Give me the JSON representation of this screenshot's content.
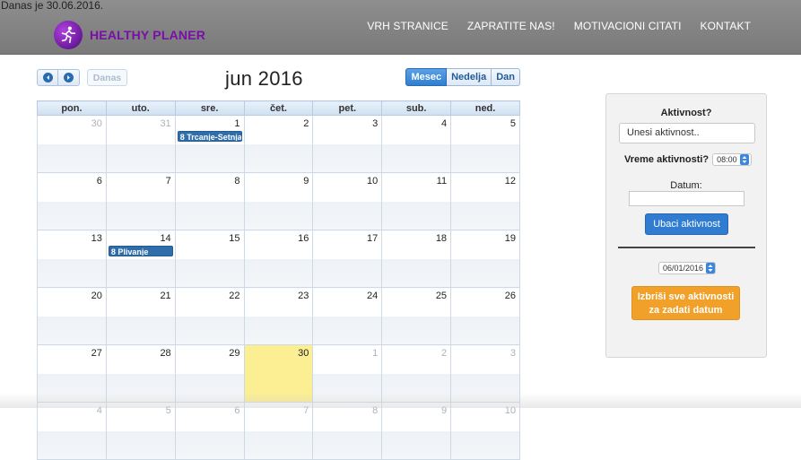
{
  "header": {
    "date_line": "Danas je 30.06.2016.",
    "brand": "HEALTHY PLANER",
    "nav": [
      "VRH STRANICE",
      "ZAPRATITE NAS!",
      "MOTIVACIONI CITATI",
      "KONTAKT"
    ]
  },
  "calendar": {
    "title": "jun 2016",
    "today_label": "Danas",
    "views": [
      "Mesec",
      "Nedelja",
      "Dan"
    ],
    "active_view": "Mesec",
    "weekdays": [
      "pon.",
      "uto.",
      "sre.",
      "čet.",
      "pet.",
      "sub.",
      "ned."
    ],
    "weeks": [
      [
        {
          "d": "30",
          "o": true
        },
        {
          "d": "31",
          "o": true
        },
        {
          "d": "1",
          "e": "8 Trcanje-Setnja-"
        },
        {
          "d": "2"
        },
        {
          "d": "3"
        },
        {
          "d": "4"
        },
        {
          "d": "5"
        }
      ],
      [
        {
          "d": "6"
        },
        {
          "d": "7"
        },
        {
          "d": "8"
        },
        {
          "d": "9"
        },
        {
          "d": "10"
        },
        {
          "d": "11"
        },
        {
          "d": "12"
        }
      ],
      [
        {
          "d": "13"
        },
        {
          "d": "14",
          "e": "8 Plivanje"
        },
        {
          "d": "15"
        },
        {
          "d": "16"
        },
        {
          "d": "17"
        },
        {
          "d": "18"
        },
        {
          "d": "19"
        }
      ],
      [
        {
          "d": "20"
        },
        {
          "d": "21"
        },
        {
          "d": "22"
        },
        {
          "d": "23"
        },
        {
          "d": "24"
        },
        {
          "d": "25"
        },
        {
          "d": "26"
        }
      ],
      [
        {
          "d": "27"
        },
        {
          "d": "28"
        },
        {
          "d": "29"
        },
        {
          "d": "30",
          "t": true
        },
        {
          "d": "1",
          "o": true
        },
        {
          "d": "2",
          "o": true
        },
        {
          "d": "3",
          "o": true
        }
      ],
      [
        {
          "d": "4",
          "o": true
        },
        {
          "d": "5",
          "o": true
        },
        {
          "d": "6",
          "o": true
        },
        {
          "d": "7",
          "o": true
        },
        {
          "d": "8",
          "o": true
        },
        {
          "d": "9",
          "o": true
        },
        {
          "d": "10",
          "o": true
        }
      ]
    ]
  },
  "panel": {
    "title": "Aktivnost?",
    "activity_placeholder": "Unesi aktivnost..",
    "time_label": "Vreme aktivnosti?",
    "time_value": "08:00",
    "date_label": "Datum:",
    "add_button": "Ubaci aktivnost",
    "delete_date_value": "06/01/2016",
    "delete_button": "Izbriši sve aktivnosti za zadati datum"
  },
  "colors": {
    "brand": "#7a0ea8",
    "accent": "#2f7cd1",
    "warning": "#f1a12a",
    "today": "#fcee92"
  }
}
